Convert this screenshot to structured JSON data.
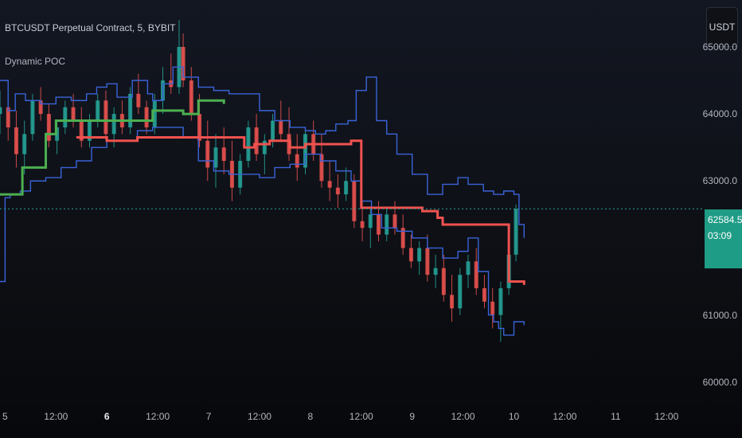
{
  "header": {
    "title": "BTCUSDT Perpetual Contract, 5, BYBIT",
    "indicator": "Dynamic POC",
    "currency_button": "USDT"
  },
  "price_tag": {
    "price": "62584.5",
    "countdown": "03:09"
  },
  "colors": {
    "background": "#131722",
    "band": "#3a63d8",
    "poc_up": "#4caf50",
    "poc_down": "#f0524f",
    "candle_up": "#26a69a",
    "candle_down": "#ef5350",
    "last_price_line": "#26a69a"
  },
  "chart_data": {
    "type": "line",
    "x_tick_labels": [
      "5",
      "12:00",
      "6",
      "12:00",
      "7",
      "12:00",
      "8",
      "12:00",
      "9",
      "12:00",
      "10",
      "12:00",
      "11",
      "12:00"
    ],
    "x_tick_bold": [
      false,
      false,
      true,
      false,
      false,
      false,
      false,
      false,
      false,
      false,
      false,
      false,
      false,
      false
    ],
    "y_tick_labels": [
      "65000.0",
      "64000.0",
      "63000.0",
      "61000.0",
      "60000.0"
    ],
    "y_tick_values": [
      65000,
      64000,
      63000,
      61000,
      60000
    ],
    "ylim": [
      59700,
      65700
    ],
    "xlim": [
      0,
      6.9
    ],
    "last_price": 62584.5,
    "series": [
      {
        "role": "upper-band",
        "color": "#3a63d8",
        "x": [
          0,
          0.08,
          0.15,
          0.25,
          0.4,
          0.55,
          0.7,
          0.85,
          0.95,
          1.05,
          1.15,
          1.3,
          1.45,
          1.5,
          1.6,
          1.7,
          1.8,
          1.95,
          2.1,
          2.25,
          2.4,
          2.55,
          2.7,
          2.85,
          3.0,
          3.1,
          3.2,
          3.3,
          3.42,
          3.5,
          3.6,
          3.7,
          3.8,
          3.9,
          4.05,
          4.2,
          4.35,
          4.5,
          4.6,
          4.75,
          4.85,
          4.95,
          5.05,
          5.1,
          5.15
        ],
        "y": [
          64500,
          64050,
          64300,
          64200,
          64150,
          64250,
          64200,
          64300,
          64400,
          64450,
          64250,
          64500,
          64300,
          64200,
          64450,
          64700,
          64550,
          64400,
          64350,
          64300,
          64300,
          64050,
          63900,
          63800,
          63750,
          63700,
          63750,
          63850,
          63900,
          64350,
          64550,
          63900,
          63700,
          63400,
          63100,
          62800,
          62950,
          63050,
          62950,
          62850,
          62800,
          62850,
          62800,
          62350,
          62150
        ]
      },
      {
        "role": "lower-band",
        "color": "#3a63d8",
        "x": [
          0,
          0.05,
          0.1,
          0.2,
          0.3,
          0.45,
          0.6,
          0.75,
          0.9,
          1.05,
          1.2,
          1.35,
          1.5,
          1.65,
          1.8,
          1.95,
          2.1,
          2.25,
          2.4,
          2.55,
          2.7,
          2.85,
          3.0,
          3.15,
          3.3,
          3.45,
          3.55,
          3.65,
          3.75,
          3.9,
          4.05,
          4.2,
          4.35,
          4.5,
          4.6,
          4.7,
          4.8,
          4.85,
          4.9,
          4.95,
          5.05,
          5.15
        ],
        "y": [
          61500,
          62750,
          62800,
          62850,
          63000,
          63050,
          63200,
          63300,
          63500,
          63600,
          63600,
          63750,
          63800,
          63800,
          63650,
          63300,
          63150,
          63100,
          63100,
          63050,
          63200,
          63250,
          63400,
          63300,
          63150,
          63000,
          62700,
          62500,
          62300,
          62250,
          62150,
          62000,
          61850,
          61950,
          62150,
          61650,
          61000,
          60900,
          60800,
          60700,
          60900,
          60850
        ]
      },
      {
        "role": "poc",
        "color": "#4caf50",
        "x": [
          0,
          0.15,
          0.22,
          0.35,
          0.45,
          0.55,
          0.7,
          1.35,
          1.5,
          1.6,
          1.8,
          1.95,
          2.05,
          2.2
        ],
        "y": [
          62800,
          62800,
          63200,
          63200,
          63700,
          63900,
          63900,
          63900,
          64050,
          64050,
          64000,
          64200,
          64200,
          64150
        ]
      },
      {
        "role": "poc",
        "color": "#f0524f",
        "x": [
          0.75,
          0.95,
          1.05,
          1.2,
          1.35,
          2.15,
          2.4,
          2.5,
          2.65,
          2.75,
          2.85,
          3.0,
          3.2,
          3.45,
          3.55,
          3.75,
          3.95,
          4.15,
          4.3,
          4.35,
          4.5,
          4.65,
          4.75,
          5.0,
          5.05,
          5.15
        ],
        "y": [
          63650,
          63650,
          63600,
          63600,
          63650,
          63650,
          63500,
          63550,
          63600,
          63600,
          63500,
          63550,
          63550,
          63600,
          62600,
          62600,
          62600,
          62550,
          62450,
          62350,
          62350,
          62350,
          62350,
          61500,
          61500,
          61450
        ]
      }
    ],
    "candles": [
      [
        0,
        64000,
        64350,
        63700,
        64100
      ],
      [
        0.08,
        64100,
        64200,
        63600,
        63800
      ],
      [
        0.16,
        63800,
        64050,
        63200,
        63400
      ],
      [
        0.24,
        63400,
        63900,
        63100,
        63700
      ],
      [
        0.32,
        63700,
        64300,
        63600,
        64200
      ],
      [
        0.4,
        64200,
        64400,
        63900,
        64000
      ],
      [
        0.48,
        64000,
        64150,
        63500,
        63600
      ],
      [
        0.56,
        63600,
        63900,
        63400,
        63800
      ],
      [
        0.64,
        63800,
        64200,
        63700,
        64100
      ],
      [
        0.72,
        64100,
        64300,
        63800,
        63900
      ],
      [
        0.8,
        63900,
        64100,
        63500,
        63600
      ],
      [
        0.88,
        63600,
        64000,
        63500,
        63900
      ],
      [
        0.96,
        63900,
        64300,
        63800,
        64200
      ],
      [
        1.04,
        64200,
        64350,
        63600,
        63700
      ],
      [
        1.12,
        63700,
        64100,
        63500,
        64000
      ],
      [
        1.2,
        64000,
        64200,
        63700,
        63800
      ],
      [
        1.28,
        63800,
        64400,
        63700,
        64300
      ],
      [
        1.36,
        64300,
        64600,
        64000,
        64100
      ],
      [
        1.44,
        64100,
        64200,
        63700,
        63800
      ],
      [
        1.52,
        63800,
        64300,
        63700,
        64200
      ],
      [
        1.6,
        64200,
        64700,
        64000,
        64500
      ],
      [
        1.68,
        64500,
        64900,
        64300,
        64400
      ],
      [
        1.76,
        64400,
        65400,
        64300,
        65000
      ],
      [
        1.8,
        65000,
        65200,
        64400,
        64500
      ],
      [
        1.88,
        64500,
        64700,
        63900,
        64000
      ],
      [
        1.96,
        64000,
        64300,
        63500,
        63600
      ],
      [
        2.04,
        63600,
        63900,
        63000,
        63200
      ],
      [
        2.12,
        63200,
        63700,
        62900,
        63500
      ],
      [
        2.2,
        63500,
        63800,
        63100,
        63300
      ],
      [
        2.28,
        63300,
        63600,
        62700,
        62900
      ],
      [
        2.36,
        62900,
        63400,
        62800,
        63300
      ],
      [
        2.44,
        63300,
        63900,
        63200,
        63800
      ],
      [
        2.52,
        63800,
        64000,
        63300,
        63400
      ],
      [
        2.6,
        63400,
        63700,
        63100,
        63600
      ],
      [
        2.68,
        63600,
        64000,
        63500,
        63900
      ],
      [
        2.76,
        63900,
        64200,
        63600,
        63700
      ],
      [
        2.84,
        63700,
        64100,
        63300,
        63400
      ],
      [
        2.92,
        63400,
        63700,
        63000,
        63200
      ],
      [
        3.0,
        63200,
        63800,
        63100,
        63700
      ],
      [
        3.08,
        63700,
        63900,
        63300,
        63400
      ],
      [
        3.16,
        63400,
        63700,
        62900,
        63000
      ],
      [
        3.24,
        63000,
        63300,
        62700,
        62900
      ],
      [
        3.32,
        62900,
        63100,
        62600,
        62800
      ],
      [
        3.4,
        62800,
        63200,
        62700,
        63000
      ],
      [
        3.48,
        63000,
        63100,
        62300,
        62400
      ],
      [
        3.56,
        62400,
        62700,
        62100,
        62300
      ],
      [
        3.64,
        62300,
        62600,
        62000,
        62500
      ],
      [
        3.72,
        62500,
        62700,
        62100,
        62200
      ],
      [
        3.8,
        62200,
        62600,
        62100,
        62500
      ],
      [
        3.88,
        62500,
        62700,
        62200,
        62300
      ],
      [
        3.96,
        62300,
        62500,
        61900,
        62000
      ],
      [
        4.04,
        62000,
        62200,
        61700,
        61800
      ],
      [
        4.12,
        61800,
        62100,
        61600,
        62000
      ],
      [
        4.2,
        62000,
        62200,
        61500,
        61600
      ],
      [
        4.28,
        61600,
        61900,
        61400,
        61700
      ],
      [
        4.36,
        61700,
        61900,
        61200,
        61300
      ],
      [
        4.44,
        61300,
        61600,
        60900,
        61100
      ],
      [
        4.52,
        61100,
        61700,
        61000,
        61600
      ],
      [
        4.6,
        61600,
        61900,
        61400,
        61800
      ],
      [
        4.68,
        61800,
        62000,
        61300,
        61400
      ],
      [
        4.76,
        61400,
        61600,
        61100,
        61200
      ],
      [
        4.84,
        61200,
        61400,
        60800,
        61000
      ],
      [
        4.92,
        61000,
        61500,
        60600,
        61400
      ],
      [
        5.0,
        61400,
        62000,
        61300,
        61900
      ],
      [
        5.07,
        61900,
        62650,
        61800,
        62584
      ]
    ]
  }
}
